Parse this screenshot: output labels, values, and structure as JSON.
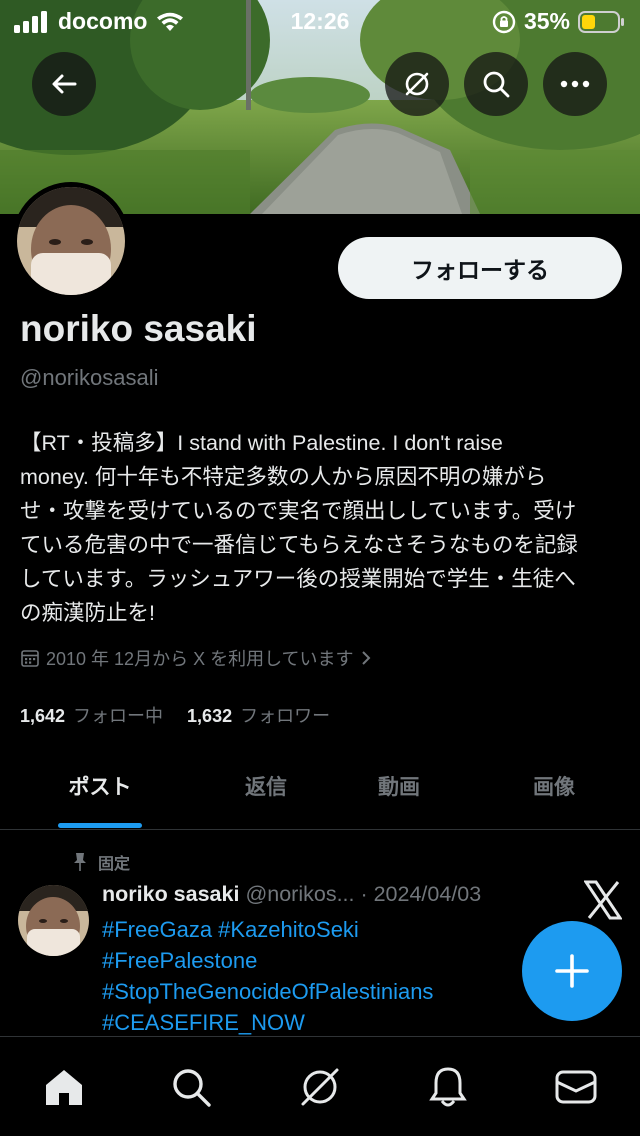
{
  "status_bar": {
    "carrier": "docomo",
    "time": "12:26",
    "battery": "35%"
  },
  "profile": {
    "name": "noriko sasaki",
    "handle": "@norikosasali",
    "follow_label": "フォローする",
    "bio_lines": [
      "【RT・投稿多】I stand with Palestine. I don't raise",
      "money. 何十年も不特定多数の人から原因不明の嫌がら",
      "せ・攻撃を受けているので実名で顔出ししています。受け",
      "ている危害の中で一番信じてもらえなさそうなものを記録",
      "しています。ラッシュアワー後の授業開始で学生・生徒へ",
      "の痴漢防止を!"
    ],
    "joined": "2010 年 12月から X を利用しています",
    "following_count": "1,642",
    "following_label": "フォロー中",
    "followers_count": "1,632",
    "followers_label": "フォロワー"
  },
  "tabs": [
    {
      "label": "ポスト",
      "active": true
    },
    {
      "label": "返信",
      "active": false
    },
    {
      "label": "動画",
      "active": false
    },
    {
      "label": "画像",
      "active": false
    }
  ],
  "pinned_post": {
    "pinned_label": "固定",
    "author_name": "noriko sasaki",
    "author_meta": "@norikos... · 2024/04/03",
    "lines": [
      "#FreeGaza #KazehitoSeki",
      "#FreePalestone",
      "#StopTheGenocideOfPalestinians",
      "#CEASEFIRE_NOW"
    ]
  },
  "colors": {
    "accent": "#1d9bf0",
    "background": "#000000",
    "muted": "#71767b"
  },
  "icons": [
    "back-arrow-icon",
    "grok-icon",
    "search-icon",
    "more-icon",
    "calendar-icon",
    "pin-icon",
    "x-logo-icon",
    "compose-plus-icon",
    "home-icon",
    "explore-icon",
    "grok-icon",
    "notifications-icon",
    "messages-icon"
  ]
}
